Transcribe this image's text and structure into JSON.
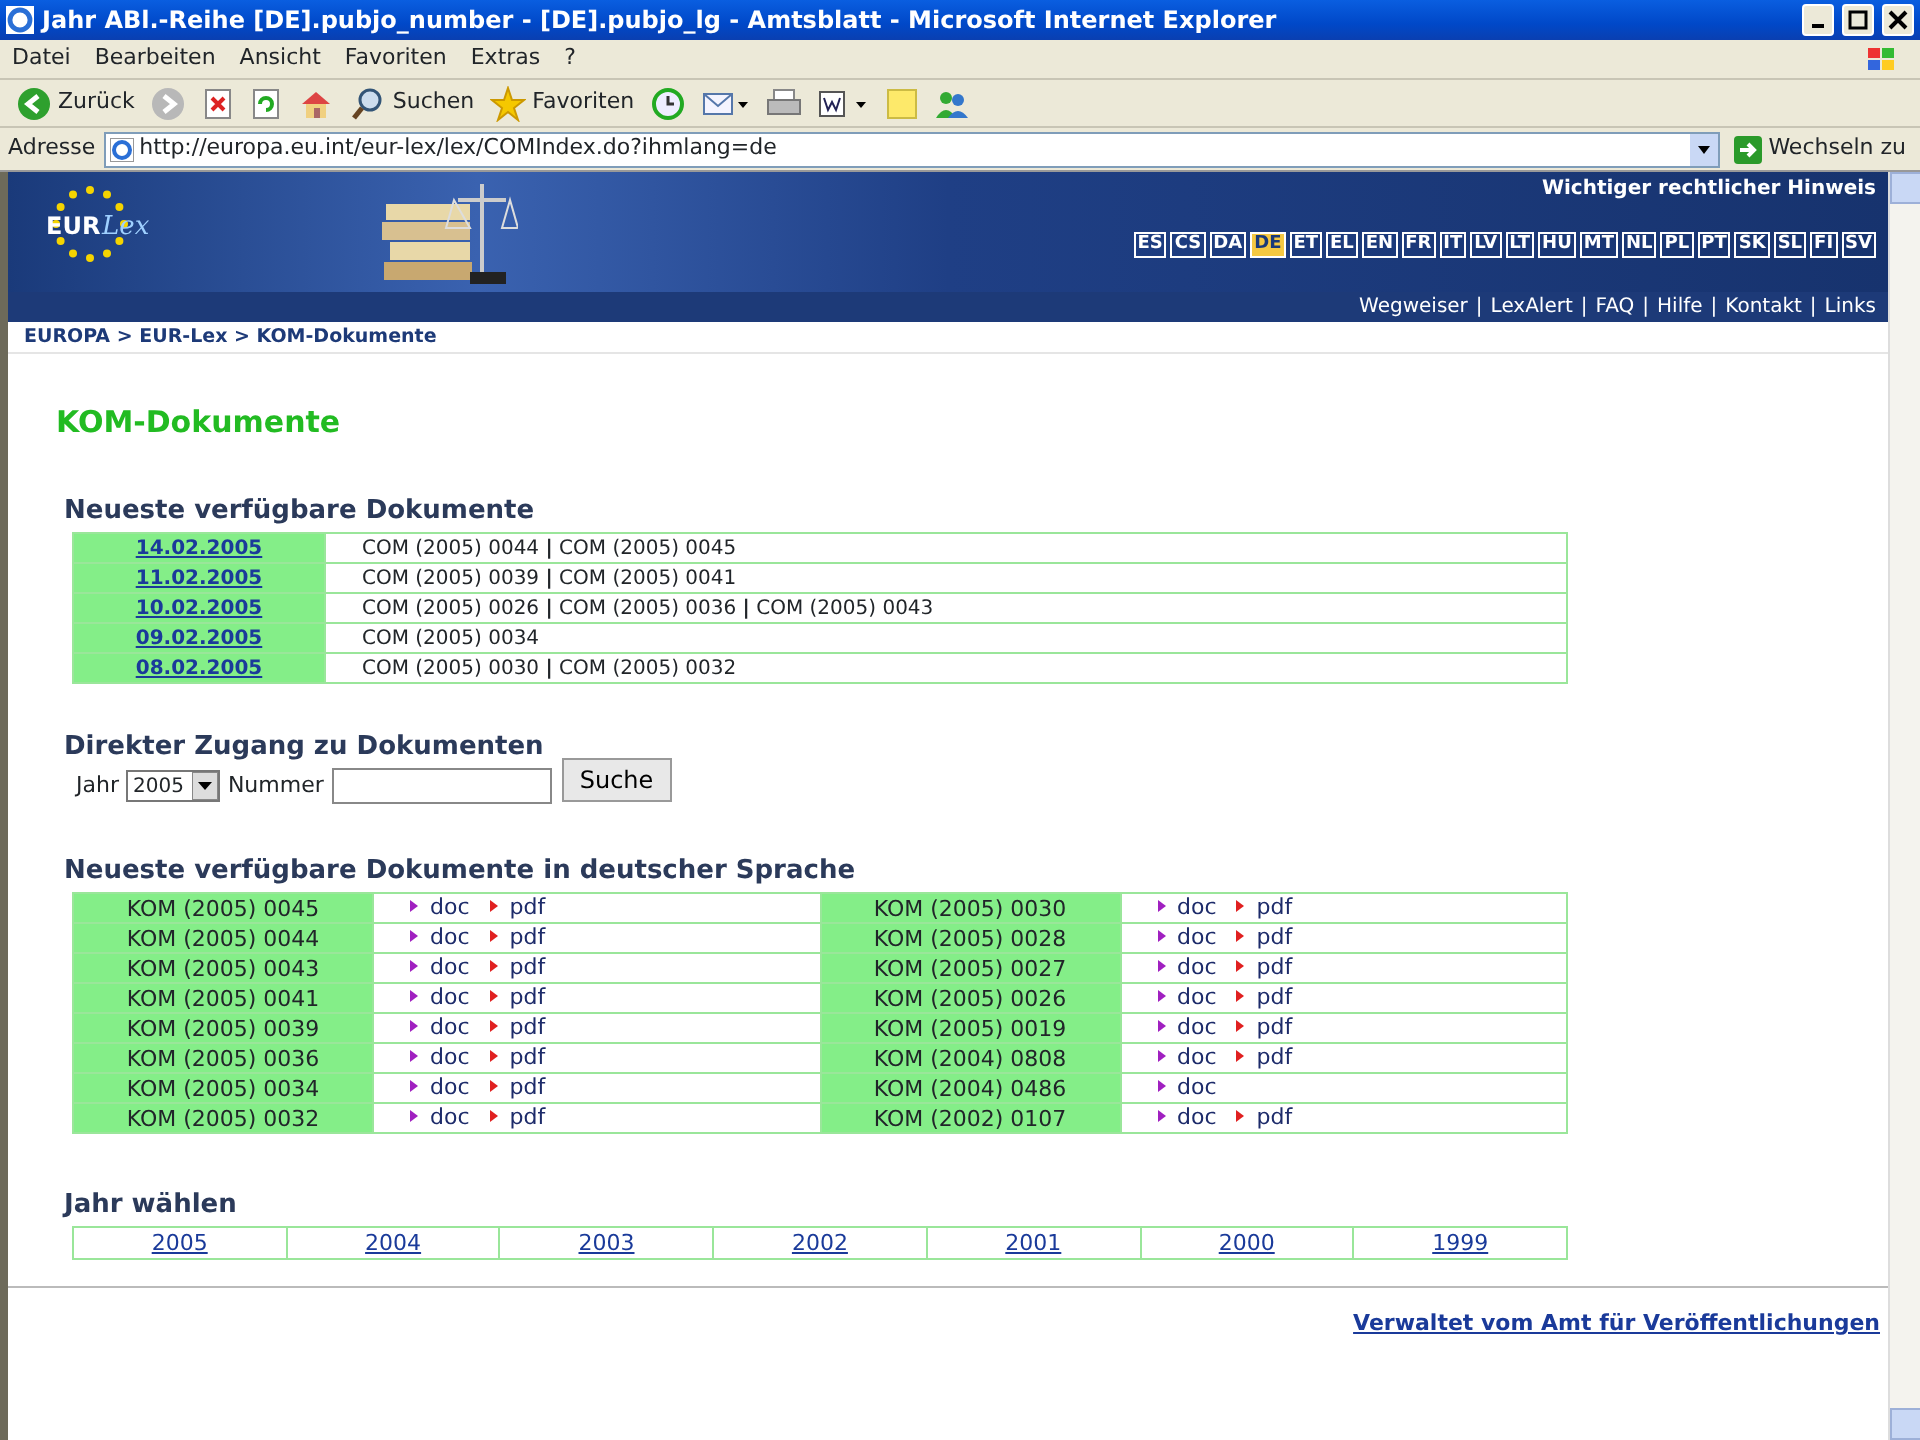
{
  "window": {
    "title": "Jahr ABl.-Reihe [DE].pubjo_number - [DE].pubjo_lg - Amtsblatt - Microsoft Internet Explorer"
  },
  "menu": [
    "Datei",
    "Bearbeiten",
    "Ansicht",
    "Favoriten",
    "Extras",
    "?"
  ],
  "toolbar": [
    {
      "kind": "back",
      "label": "Zurück"
    },
    {
      "kind": "forward"
    },
    {
      "kind": "stop"
    },
    {
      "kind": "refresh"
    },
    {
      "kind": "home"
    },
    {
      "kind": "search",
      "label": "Suchen"
    },
    {
      "kind": "favorites",
      "label": "Favoriten"
    },
    {
      "kind": "history"
    },
    {
      "kind": "mail"
    },
    {
      "kind": "print"
    },
    {
      "kind": "edit"
    },
    {
      "kind": "note"
    },
    {
      "kind": "messenger"
    }
  ],
  "address": {
    "label": "Adresse",
    "url": "http://europa.eu.int/eur-lex/lex/COMIndex.do?ihmlang=de",
    "go": "Wechseln zu"
  },
  "banner": {
    "logo": [
      "EUR",
      "Lex"
    ],
    "legal_notice": "Wichtiger rechtlicher Hinweis",
    "languages": [
      {
        "code": "ES",
        "selected": false
      },
      {
        "code": "CS",
        "selected": false
      },
      {
        "code": "DA",
        "selected": false
      },
      {
        "code": "DE",
        "selected": true
      },
      {
        "code": "ET",
        "selected": false
      },
      {
        "code": "EL",
        "selected": false
      },
      {
        "code": "EN",
        "selected": false
      },
      {
        "code": "FR",
        "selected": false
      },
      {
        "code": "IT",
        "selected": false
      },
      {
        "code": "LV",
        "selected": false
      },
      {
        "code": "LT",
        "selected": false
      },
      {
        "code": "HU",
        "selected": false
      },
      {
        "code": "MT",
        "selected": false
      },
      {
        "code": "NL",
        "selected": false
      },
      {
        "code": "PL",
        "selected": false
      },
      {
        "code": "PT",
        "selected": false
      },
      {
        "code": "SK",
        "selected": false
      },
      {
        "code": "SL",
        "selected": false
      },
      {
        "code": "FI",
        "selected": false
      },
      {
        "code": "SV",
        "selected": false
      }
    ],
    "separator": "|",
    "links": [
      "Wegweiser",
      "LexAlert",
      "FAQ",
      "Hilfe",
      "Kontakt",
      "Links"
    ]
  },
  "breadcrumb": "EUROPA > EUR-Lex > KOM-Dokumente",
  "page_title": "KOM-Dokumente",
  "recent": {
    "heading": "Neueste verfügbare Dokumente",
    "rows": [
      {
        "date": "14.02.2005",
        "documents": "COM (2005) 0044 **|** COM (2005) 0045"
      },
      {
        "date": "11.02.2005",
        "documents": "COM (2005) 0039 **|** COM (2005) 0041"
      },
      {
        "date": "10.02.2005",
        "documents": "COM (2005) 0026 **|** COM (2005) 0036 **|** COM (2005) 0043"
      },
      {
        "date": "09.02.2005",
        "documents": "COM (2005) 0034"
      },
      {
        "date": "08.02.2005",
        "documents": "COM (2005) 0030 **|** COM (2005) 0032"
      }
    ]
  },
  "direct_access": {
    "heading": "Direkter Zugang zu Dokumenten",
    "year_label": "Jahr",
    "year_value": "2005",
    "number_label": "Nummer",
    "search_button": "Suche"
  },
  "german": {
    "heading": "Neueste verfügbare Dokumente in deutscher Sprache",
    "rows": [
      {
        "cells": [
          {
            "number": "KOM (2005) 0045",
            "links": [
              {
                "kind": "doc",
                "label": "doc"
              },
              {
                "kind": "pdf",
                "label": "pdf"
              }
            ]
          },
          {
            "number": "KOM (2005) 0030",
            "links": [
              {
                "kind": "doc",
                "label": "doc"
              },
              {
                "kind": "pdf",
                "label": "pdf"
              }
            ]
          }
        ]
      },
      {
        "cells": [
          {
            "number": "KOM (2005) 0044",
            "links": [
              {
                "kind": "doc",
                "label": "doc"
              },
              {
                "kind": "pdf",
                "label": "pdf"
              }
            ]
          },
          {
            "number": "KOM (2005) 0028",
            "links": [
              {
                "kind": "doc",
                "label": "doc"
              },
              {
                "kind": "pdf",
                "label": "pdf"
              }
            ]
          }
        ]
      },
      {
        "cells": [
          {
            "number": "KOM (2005) 0043",
            "links": [
              {
                "kind": "doc",
                "label": "doc"
              },
              {
                "kind": "pdf",
                "label": "pdf"
              }
            ]
          },
          {
            "number": "KOM (2005) 0027",
            "links": [
              {
                "kind": "doc",
                "label": "doc"
              },
              {
                "kind": "pdf",
                "label": "pdf"
              }
            ]
          }
        ]
      },
      {
        "cells": [
          {
            "number": "KOM (2005) 0041",
            "links": [
              {
                "kind": "doc",
                "label": "doc"
              },
              {
                "kind": "pdf",
                "label": "pdf"
              }
            ]
          },
          {
            "number": "KOM (2005) 0026",
            "links": [
              {
                "kind": "doc",
                "label": "doc"
              },
              {
                "kind": "pdf",
                "label": "pdf"
              }
            ]
          }
        ]
      },
      {
        "cells": [
          {
            "number": "KOM (2005) 0039",
            "links": [
              {
                "kind": "doc",
                "label": "doc"
              },
              {
                "kind": "pdf",
                "label": "pdf"
              }
            ]
          },
          {
            "number": "KOM (2005) 0019",
            "links": [
              {
                "kind": "doc",
                "label": "doc"
              },
              {
                "kind": "pdf",
                "label": "pdf"
              }
            ]
          }
        ]
      },
      {
        "cells": [
          {
            "number": "KOM (2005) 0036",
            "links": [
              {
                "kind": "doc",
                "label": "doc"
              },
              {
                "kind": "pdf",
                "label": "pdf"
              }
            ]
          },
          {
            "number": "KOM (2004) 0808",
            "links": [
              {
                "kind": "doc",
                "label": "doc"
              },
              {
                "kind": "pdf",
                "label": "pdf"
              }
            ]
          }
        ]
      },
      {
        "cells": [
          {
            "number": "KOM (2005) 0034",
            "links": [
              {
                "kind": "doc",
                "label": "doc"
              },
              {
                "kind": "pdf",
                "label": "pdf"
              }
            ]
          },
          {
            "number": "KOM (2004) 0486",
            "links": [
              {
                "kind": "doc",
                "label": "doc"
              }
            ]
          }
        ]
      },
      {
        "cells": [
          {
            "number": "KOM (2005) 0032",
            "links": [
              {
                "kind": "doc",
                "label": "doc"
              },
              {
                "kind": "pdf",
                "label": "pdf"
              }
            ]
          },
          {
            "number": "KOM (2002) 0107",
            "links": [
              {
                "kind": "doc",
                "label": "doc"
              },
              {
                "kind": "pdf",
                "label": "pdf"
              }
            ]
          }
        ]
      }
    ]
  },
  "years": {
    "heading": "Jahr wählen",
    "items": [
      "2005",
      "2004",
      "2003",
      "2002",
      "2001",
      "2000",
      "1999"
    ]
  },
  "footer": "Verwaltet vom Amt für Veröffentlichungen"
}
